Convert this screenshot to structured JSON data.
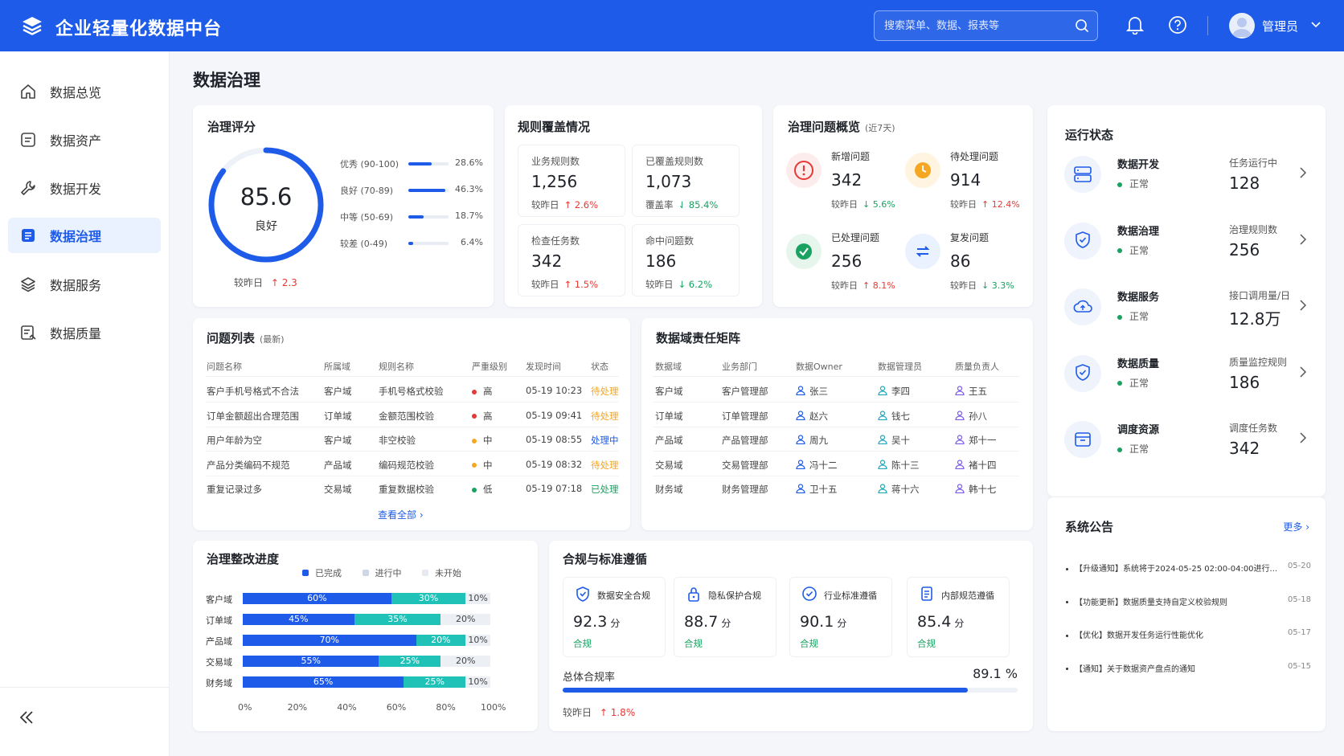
{
  "app": {
    "title": "企业轻量化数据中台",
    "user": "管理员"
  },
  "search": {
    "placeholder": "搜索菜单、数据、报表等"
  },
  "colors": {
    "primary": "#1e5be8",
    "teal": "#20c2b8",
    "red": "#e53935",
    "green": "#1aa260",
    "orange": "#f5a623"
  },
  "sidebar": {
    "items": [
      {
        "label": "数据总览",
        "icon": "home-icon"
      },
      {
        "label": "数据资产",
        "icon": "asset-icon"
      },
      {
        "label": "数据开发",
        "icon": "wrench-icon"
      },
      {
        "label": "数据治理",
        "icon": "governance-icon",
        "active": true
      },
      {
        "label": "数据服务",
        "icon": "layers-icon"
      },
      {
        "label": "数据质量",
        "icon": "quality-icon"
      }
    ]
  },
  "page": {
    "title": "数据治理"
  },
  "score": {
    "title": "治理评分",
    "value": "85.6",
    "fraction": 0.856,
    "grade": "良好",
    "compare_label": "较昨日",
    "compare_value": "2.3",
    "distribution": [
      {
        "label": "优秀 (90-100)",
        "pct": "28.6%",
        "fraction": 0.286
      },
      {
        "label": "良好 (70-89)",
        "pct": "46.3%",
        "fraction": 0.463
      },
      {
        "label": "中等 (50-69)",
        "pct": "18.7%",
        "fraction": 0.187
      },
      {
        "label": "较差 (0-49)",
        "pct": "6.4%",
        "fraction": 0.064
      }
    ]
  },
  "coverage": {
    "title": "规则覆盖情况",
    "items": [
      {
        "label": "业务规则数",
        "value": "1,256",
        "sub_label": "较昨日",
        "sub_value": "2.6%",
        "dir": "up"
      },
      {
        "label": "已覆盖规则数",
        "value": "1,073",
        "sub_label": "覆盖率",
        "sub_value": "85.4%",
        "dir": "down"
      },
      {
        "label": "检查任务数",
        "value": "342",
        "sub_label": "较昨日",
        "sub_value": "1.5%",
        "dir": "up"
      },
      {
        "label": "命中问题数",
        "value": "186",
        "sub_label": "较昨日",
        "sub_value": "6.2%",
        "dir": "down"
      }
    ]
  },
  "issues_overview": {
    "title": "治理问题概览",
    "subtitle": "(近7天)",
    "items": [
      {
        "label": "新增问题",
        "value": "342",
        "sub_label": "较昨日",
        "sub_value": "5.6%",
        "dir": "down",
        "icon": "alert-icon"
      },
      {
        "label": "待处理问题",
        "value": "914",
        "sub_label": "较昨日",
        "sub_value": "12.4%",
        "dir": "up",
        "icon": "clock-icon"
      },
      {
        "label": "已处理问题",
        "value": "256",
        "sub_label": "较昨日",
        "sub_value": "8.1%",
        "dir": "up",
        "icon": "check-icon"
      },
      {
        "label": "复发问题",
        "value": "86",
        "sub_label": "较昨日",
        "sub_value": "3.3%",
        "dir": "down",
        "icon": "recur-icon"
      }
    ]
  },
  "issue_list": {
    "title": "问题列表",
    "subtitle": "(最新)",
    "columns": [
      "问题名称",
      "所属域",
      "规则名称",
      "严重级别",
      "发现时间",
      "状态"
    ],
    "rows": [
      {
        "name": "客户手机号格式不合法",
        "domain": "客户域",
        "rule": "手机号格式校验",
        "severity": "高",
        "sev_color": "#e53935",
        "time": "05-19 10:23",
        "status": "待处理",
        "status_color": "#f5a623"
      },
      {
        "name": "订单金额超出合理范围",
        "domain": "订单域",
        "rule": "金额范围校验",
        "severity": "高",
        "sev_color": "#e53935",
        "time": "05-19 09:41",
        "status": "待处理",
        "status_color": "#f5a623"
      },
      {
        "name": "用户年龄为空",
        "domain": "客户域",
        "rule": "非空校验",
        "severity": "中",
        "sev_color": "#f5a623",
        "time": "05-19 08:55",
        "status": "处理中",
        "status_color": "#1e5be8"
      },
      {
        "name": "产品分类编码不规范",
        "domain": "产品域",
        "rule": "编码规范校验",
        "severity": "中",
        "sev_color": "#f5a623",
        "time": "05-19 08:32",
        "status": "待处理",
        "status_color": "#f5a623"
      },
      {
        "name": "重复记录过多",
        "domain": "交易域",
        "rule": "重复数据校验",
        "severity": "低",
        "sev_color": "#1aa260",
        "time": "05-19 07:18",
        "status": "已处理",
        "status_color": "#1aa260"
      }
    ],
    "view_all": "查看全部"
  },
  "matrix": {
    "title": "数据域责任矩阵",
    "columns": [
      "数据域",
      "业务部门",
      "数据Owner",
      "数据管理员",
      "质量负责人"
    ],
    "rows": [
      {
        "domain": "客户域",
        "dept": "客户管理部",
        "owner": "张三",
        "admin": "李四",
        "quality": "王五"
      },
      {
        "domain": "订单域",
        "dept": "订单管理部",
        "owner": "赵六",
        "admin": "钱七",
        "quality": "孙八"
      },
      {
        "domain": "产品域",
        "dept": "产品管理部",
        "owner": "周九",
        "admin": "吴十",
        "quality": "郑十一"
      },
      {
        "domain": "交易域",
        "dept": "交易管理部",
        "owner": "冯十二",
        "admin": "陈十三",
        "quality": "褚十四"
      },
      {
        "domain": "财务域",
        "dept": "财务管理部",
        "owner": "卫十五",
        "admin": "蒋十六",
        "quality": "韩十七"
      }
    ]
  },
  "progress": {
    "title": "治理整改进度",
    "legend": [
      "已完成",
      "进行中",
      "未开始"
    ],
    "rows": [
      {
        "domain": "客户域",
        "done": 60,
        "doing": 30,
        "todo": 10,
        "done_label": "60%",
        "doing_label": "30%",
        "todo_label": "10%"
      },
      {
        "domain": "订单域",
        "done": 45,
        "doing": 35,
        "todo": 20,
        "done_label": "45%",
        "doing_label": "35%",
        "todo_label": "20%"
      },
      {
        "domain": "产品域",
        "done": 70,
        "doing": 20,
        "todo": 10,
        "done_label": "70%",
        "doing_label": "20%",
        "todo_label": "10%"
      },
      {
        "domain": "交易域",
        "done": 55,
        "doing": 25,
        "todo": 20,
        "done_label": "55%",
        "doing_label": "25%",
        "todo_label": "20%"
      },
      {
        "domain": "财务域",
        "done": 65,
        "doing": 25,
        "todo": 10,
        "done_label": "65%",
        "doing_label": "25%",
        "todo_label": "10%"
      }
    ],
    "x_ticks": [
      "0%",
      "20%",
      "40%",
      "60%",
      "80%",
      "100%"
    ]
  },
  "compliance": {
    "title": "合规与标准遵循",
    "items": [
      {
        "label": "数据安全合规",
        "value": "92.3",
        "unit": "分",
        "status": "合规",
        "icon": "shield-check-icon"
      },
      {
        "label": "隐私保护合规",
        "value": "88.7",
        "unit": "分",
        "status": "合规",
        "icon": "lock-icon"
      },
      {
        "label": "行业标准遵循",
        "value": "90.1",
        "unit": "分",
        "status": "合规",
        "icon": "badge-check-icon"
      },
      {
        "label": "内部规范遵循",
        "value": "85.4",
        "unit": "分",
        "status": "合规",
        "icon": "document-icon"
      }
    ],
    "overall_label": "总体合规率",
    "overall_value": "89.1 %",
    "overall_fraction": 0.891,
    "compare_label": "较昨日",
    "compare_value": "1.8%"
  },
  "run_status": {
    "title": "运行状态",
    "items": [
      {
        "name": "数据开发",
        "status": "正常",
        "metric_label": "任务运行中",
        "metric_value": "128",
        "icon": "server-icon"
      },
      {
        "name": "数据治理",
        "status": "正常",
        "metric_label": "治理规则数",
        "metric_value": "256",
        "icon": "shield-icon"
      },
      {
        "name": "数据服务",
        "status": "正常",
        "metric_label": "接口调用量/日",
        "metric_value": "12.8万",
        "icon": "cloud-icon"
      },
      {
        "name": "数据质量",
        "status": "正常",
        "metric_label": "质量监控规则",
        "metric_value": "186",
        "icon": "shield-check-icon"
      },
      {
        "name": "调度资源",
        "status": "正常",
        "metric_label": "调度任务数",
        "metric_value": "342",
        "icon": "box-icon"
      }
    ]
  },
  "announcements": {
    "title": "系统公告",
    "more": "更多",
    "items": [
      {
        "text": "【升级通知】系统将于2024-05-25 02:00-04:00进行...",
        "date": "05-20"
      },
      {
        "text": "【功能更新】数据质量支持自定义校验规则",
        "date": "05-18"
      },
      {
        "text": "【优化】数据开发任务运行性能优化",
        "date": "05-17"
      },
      {
        "text": "【通知】关于数据资产盘点的通知",
        "date": "05-15"
      }
    ]
  }
}
